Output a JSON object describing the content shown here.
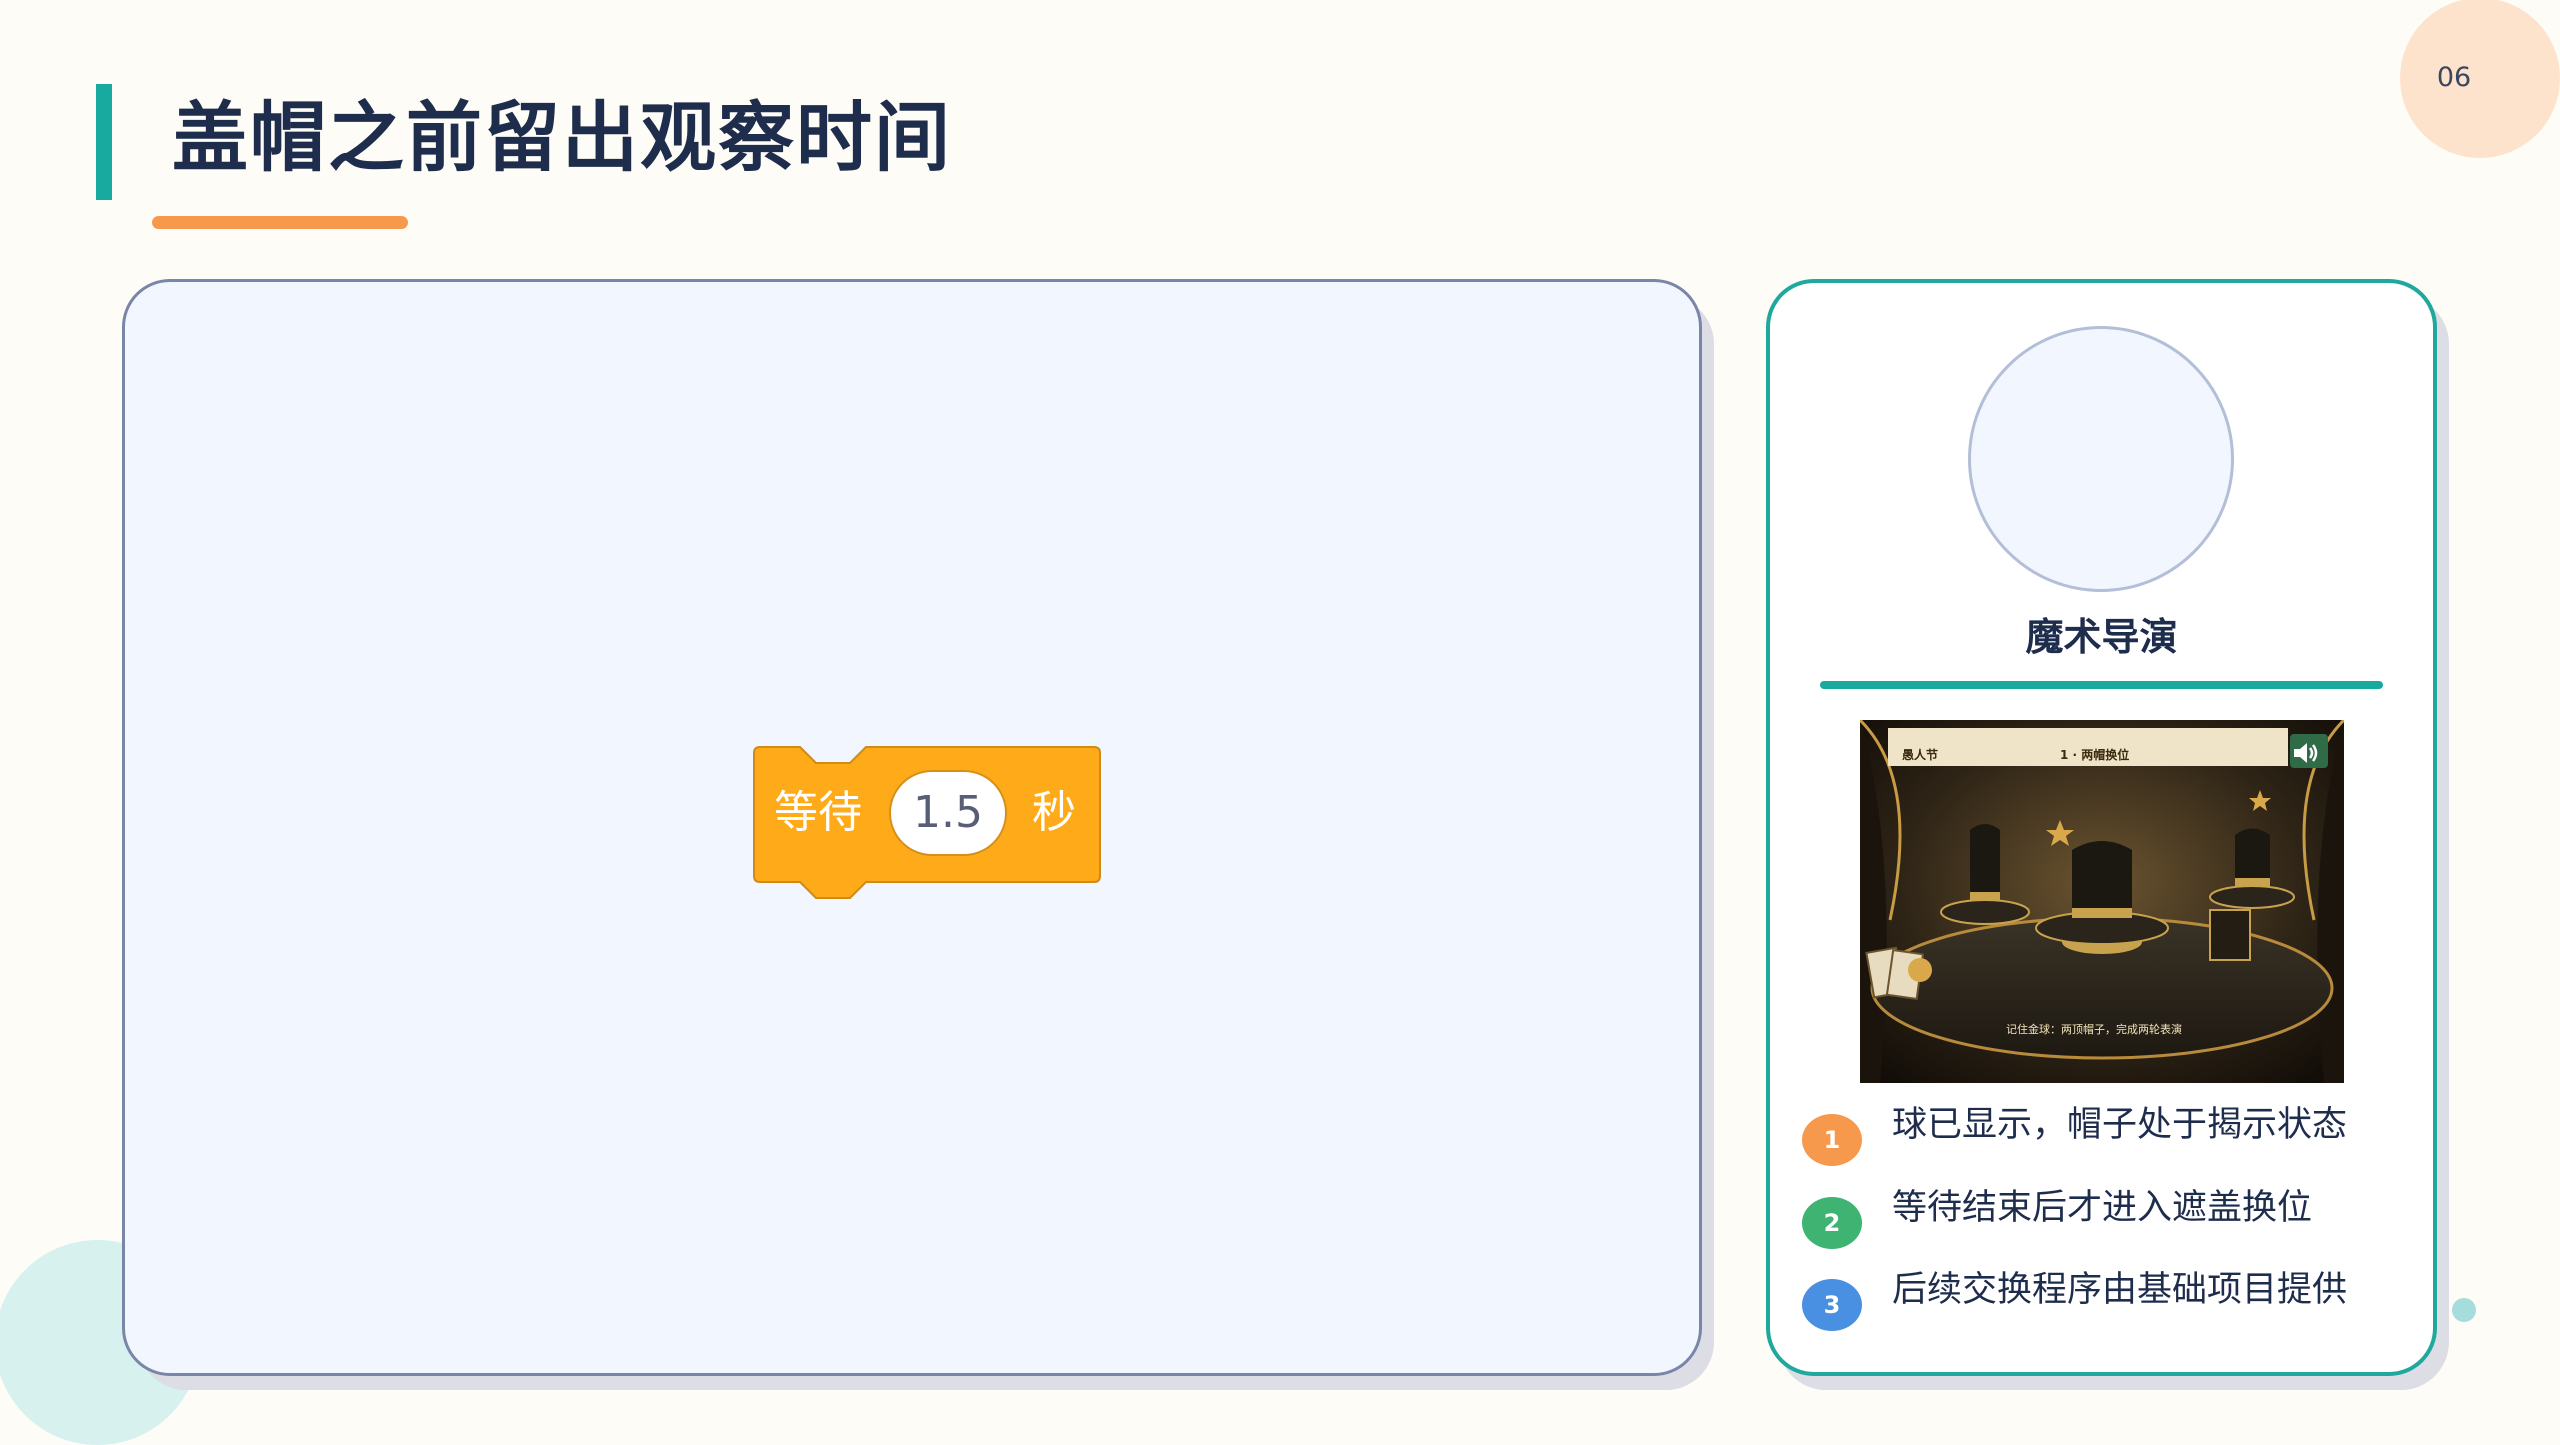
{
  "page_number": "06",
  "title": "盖帽之前留出观察时间",
  "wait_block": {
    "label": "等待",
    "value": "1.5",
    "unit": "秒",
    "color": "#ffab19"
  },
  "side_panel": {
    "role_name": "魔术导演",
    "stage": {
      "left_label": "愚人节",
      "center_label": "1 · 两帽换位",
      "caption": "记住金球：两顶帽子，完成两轮表演",
      "speaker_icon": "speaker-icon"
    },
    "steps": [
      {
        "number": "1",
        "text": "球已显示，帽子处于揭示状态",
        "color": "#f7994d"
      },
      {
        "number": "2",
        "text": "等待结束后才进入遮盖换位",
        "color": "#3fb371"
      },
      {
        "number": "3",
        "text": "后续交换程序由基础项目提供",
        "color": "#4a90e2"
      }
    ]
  },
  "colors": {
    "accent_teal": "#18a99f",
    "accent_orange": "#f7994d",
    "title_navy": "#1f2d4d"
  }
}
